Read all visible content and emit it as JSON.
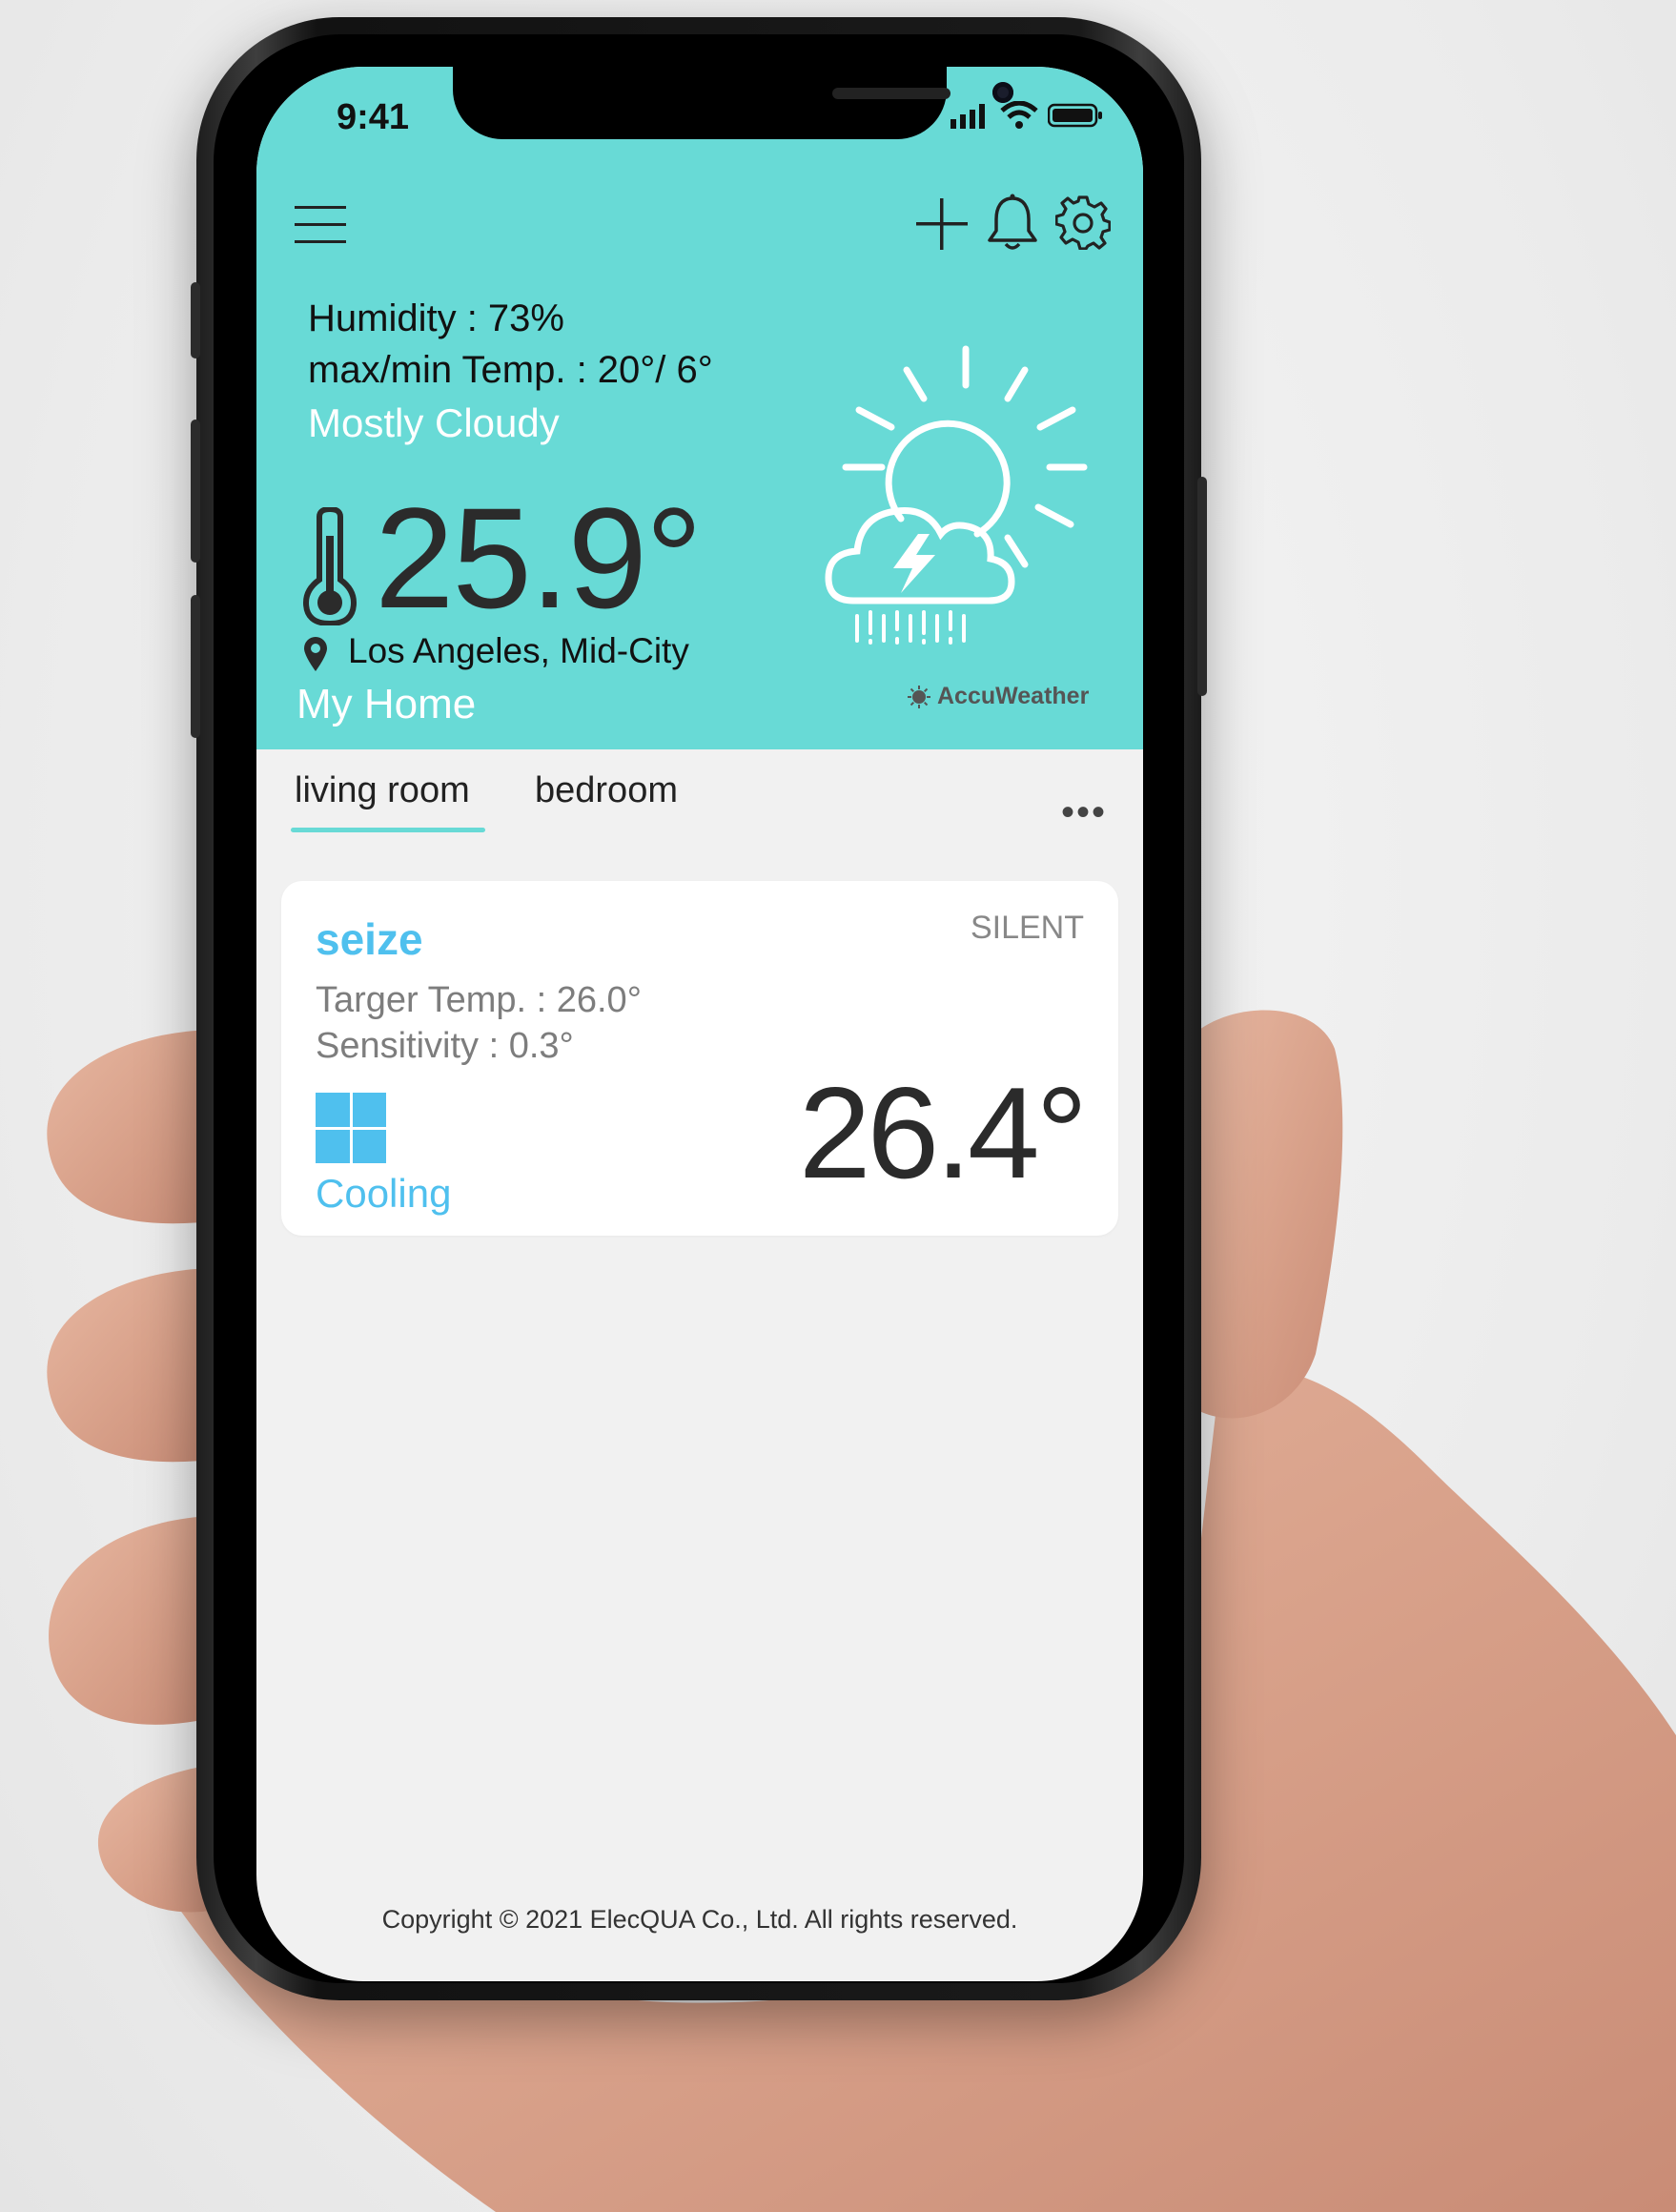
{
  "status_bar": {
    "time": "9:41"
  },
  "toolbar": {
    "menu_icon": "hamburger-icon",
    "add_icon": "plus-icon",
    "bell_icon": "bell-icon",
    "settings_icon": "gear-icon"
  },
  "weather": {
    "humidity": "Humidity : 73%",
    "max_min": "max/min Temp. : 20°/ 6°",
    "condition": "Mostly Cloudy",
    "temperature": "25.9°",
    "location": "Los Angeles, Mid-City",
    "home_name": "My Home",
    "provider": "AccuWeather",
    "icon": "sun-cloud-thunder-rain-icon"
  },
  "tabs": [
    {
      "label": "living room",
      "active": true
    },
    {
      "label": "bedroom",
      "active": false
    }
  ],
  "more_label": "•••",
  "device": {
    "name": "seize",
    "mode": "SILENT",
    "target_temp": "Targer Temp. : 26.0°",
    "sensitivity": "Sensitivity : 0.3°",
    "state": "Cooling",
    "current_temp": "26.4°"
  },
  "footer": {
    "copyright": "Copyright © 2021 ElecQUA Co., Ltd. All rights reserved."
  },
  "colors": {
    "accent": "#68dad6",
    "device_blue": "#4fc0ee"
  }
}
